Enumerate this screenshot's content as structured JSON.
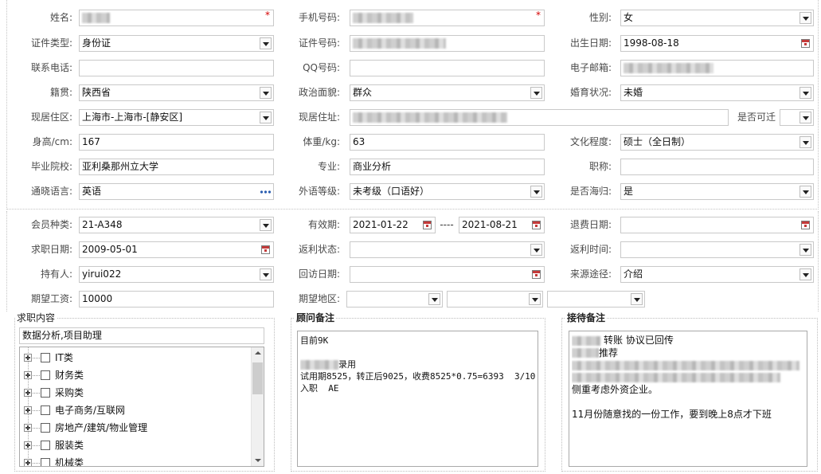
{
  "required_mark": "*",
  "colors": {
    "required_mark": "#d40000",
    "more_button": "#2a5db0",
    "calendar_icon": "#c43a3a"
  },
  "icons": {
    "dropdown": "chevron-down-icon",
    "date_picker": "calendar-icon",
    "more": "more-dots-icon",
    "tree_expand": "plus-box-icon",
    "checkbox": "checkbox-icon"
  },
  "basic": {
    "name": {
      "label": "姓名:"
    },
    "mobile": {
      "label": "手机号码:"
    },
    "gender": {
      "label": "性别:",
      "value": "女"
    },
    "id_type": {
      "label": "证件类型:",
      "value": "身份证"
    },
    "id_number": {
      "label": "证件号码:"
    },
    "birth_date": {
      "label": "出生日期:",
      "value": "1998-08-18"
    },
    "phone": {
      "label": "联系电话:"
    },
    "qq": {
      "label": "QQ号码:"
    },
    "email": {
      "label": "电子邮箱:"
    },
    "native_place": {
      "label": "籍贯:",
      "value": "陕西省"
    },
    "political_status": {
      "label": "政治面貌:",
      "value": "群众"
    },
    "marital_status": {
      "label": "婚育状况:",
      "value": "未婚"
    },
    "residence_district": {
      "label": "现居住区:",
      "value": "上海市-上海市-[静安区]"
    },
    "residence_address": {
      "label": "现居住址:"
    },
    "relocatable": {
      "label": "是否可迁"
    },
    "height": {
      "label": "身高/cm:",
      "value": "167"
    },
    "weight": {
      "label": "体重/kg:",
      "value": "63"
    },
    "education": {
      "label": "文化程度:",
      "value": "硕士（全日制）"
    },
    "school": {
      "label": "毕业院校:",
      "value": "亚利桑那州立大学"
    },
    "major": {
      "label": "专业:",
      "value": "商业分析"
    },
    "job_title": {
      "label": "职称:"
    },
    "languages": {
      "label": "通晓语言:",
      "value": "英语"
    },
    "foreign_level": {
      "label": "外语等级:",
      "value": "未考级（口语好）"
    },
    "returnee": {
      "label": "是否海归:",
      "value": "是"
    }
  },
  "membership": {
    "type": {
      "label": "会员种类:",
      "value": "21-A348"
    },
    "validity": {
      "label": "有效期:",
      "start": "2021-01-22",
      "separator": "----",
      "end": "2021-08-21"
    },
    "refund_date": {
      "label": "退费日期:"
    },
    "job_date": {
      "label": "求职日期:",
      "value": "2009-05-01"
    },
    "rebate_status": {
      "label": "返利状态:"
    },
    "rebate_time": {
      "label": "返利时间:"
    },
    "holder": {
      "label": "持有人:",
      "value": "yirui022"
    },
    "visit_date": {
      "label": "回访日期:"
    },
    "source": {
      "label": "来源途径:",
      "value": "介绍"
    },
    "expected_salary": {
      "label": "期望工资:",
      "value": "10000"
    },
    "expected_region": {
      "label": "期望地区:"
    }
  },
  "job_content": {
    "legend": "求职内容",
    "selected": "数据分析,项目助理",
    "categories": [
      "IT类",
      "财务类",
      "采购类",
      "电子商务/互联网",
      "房地产/建筑/物业管理",
      "服装类",
      "机械类"
    ]
  },
  "consultant_notes": {
    "legend": "顾问备注",
    "lines": [
      "目前9K",
      "录用",
      "试用期8525，转正后9025，收费8525*0.75=6393  3/10",
      "入职  AE"
    ]
  },
  "reception_notes": {
    "legend": "接待备注",
    "lines": [
      "转账 协议已回传",
      "推荐",
      "侧重考虑外资企业。",
      "11月份随意找的一份工作，要到晚上8点才下班"
    ]
  }
}
